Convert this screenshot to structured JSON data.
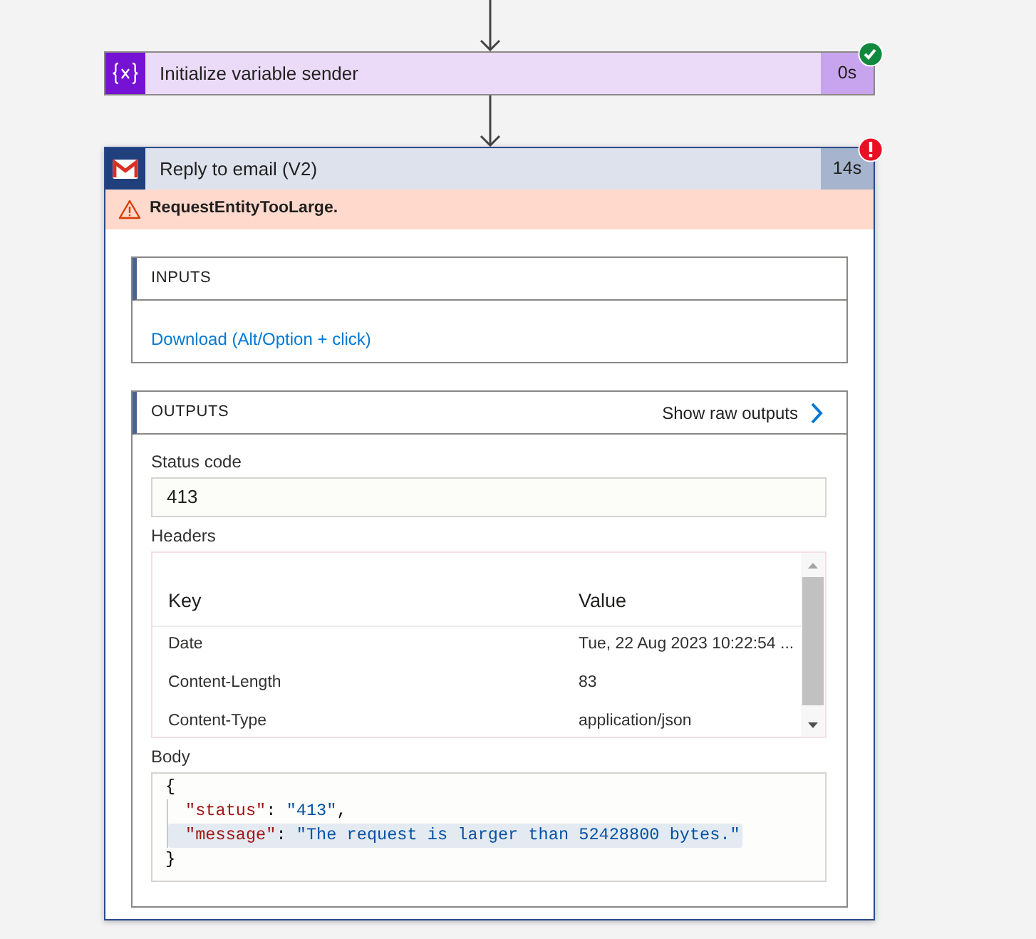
{
  "steps": [
    {
      "kind": "variable",
      "title": "Initialize variable sender",
      "duration": "0s",
      "failed": false,
      "expanded": false
    },
    {
      "kind": "gmail",
      "title": "Reply to email (V2)",
      "duration": "14s",
      "failed": true,
      "expanded": true,
      "error": "RequestEntityTooLarge.",
      "inputs": {
        "heading": "INPUTS",
        "link": "Download (Alt/Option + click)"
      },
      "outputs": {
        "heading": "OUTPUTS",
        "action": "Show raw outputs",
        "fields": [
          {
            "kind": "text",
            "label": "Status code",
            "value": "413"
          },
          {
            "kind": "table",
            "label": "Headers",
            "columns": [
              "Key",
              "Value"
            ],
            "rows": [
              [
                "Date",
                "Tue, 22 Aug 2023 10:22:54 ..."
              ],
              [
                "Content-Length",
                "83"
              ],
              [
                "Content-Type",
                "application/json"
              ]
            ]
          },
          {
            "kind": "code",
            "label": "Body",
            "lines": [
              {
                "highlighted": false,
                "tokens": [
                  {
                    "kind": "punct",
                    "text": "{"
                  }
                ],
                "children": [
                  {
                    "highlighted": false,
                    "tokens": [
                      {
                        "kind": "key",
                        "text": "\"status\""
                      },
                      {
                        "kind": "punct",
                        "text": ": "
                      },
                      {
                        "kind": "string",
                        "text": "\"413\""
                      },
                      {
                        "kind": "punct",
                        "text": ","
                      }
                    ]
                  },
                  {
                    "highlighted": true,
                    "tokens": [
                      {
                        "kind": "key",
                        "text": "\"message\""
                      },
                      {
                        "kind": "punct",
                        "text": ": "
                      },
                      {
                        "kind": "string",
                        "text": "\"The request is larger than 52428800 bytes.\""
                      }
                    ]
                  }
                ]
              },
              {
                "highlighted": false,
                "tokens": [
                  {
                    "kind": "punct",
                    "text": "}"
                  }
                ]
              }
            ]
          }
        ]
      }
    }
  ]
}
